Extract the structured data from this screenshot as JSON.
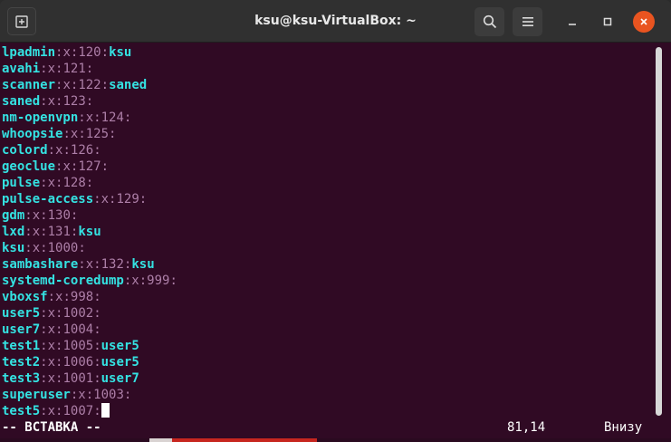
{
  "window": {
    "title": "ksu@ksu-VirtualBox: ~"
  },
  "icons": {
    "new_tab": "new-tab-icon",
    "search": "search-icon",
    "menu": "hamburger-menu-icon",
    "minimize": "minimize-icon",
    "maximize": "maximize-icon",
    "close": "close-icon"
  },
  "colors": {
    "terminal_bg": "#300a24",
    "username": "#34e2e2",
    "separator": "#ad7fa8",
    "close_button": "#e95420"
  },
  "lines": [
    {
      "name": "lpadmin",
      "gid": "120",
      "members": "ksu"
    },
    {
      "name": "avahi",
      "gid": "121",
      "members": ""
    },
    {
      "name": "scanner",
      "gid": "122",
      "members": "saned"
    },
    {
      "name": "saned",
      "gid": "123",
      "members": ""
    },
    {
      "name": "nm-openvpn",
      "gid": "124",
      "members": ""
    },
    {
      "name": "whoopsie",
      "gid": "125",
      "members": ""
    },
    {
      "name": "colord",
      "gid": "126",
      "members": ""
    },
    {
      "name": "geoclue",
      "gid": "127",
      "members": ""
    },
    {
      "name": "pulse",
      "gid": "128",
      "members": ""
    },
    {
      "name": "pulse-access",
      "gid": "129",
      "members": ""
    },
    {
      "name": "gdm",
      "gid": "130",
      "members": ""
    },
    {
      "name": "lxd",
      "gid": "131",
      "members": "ksu"
    },
    {
      "name": "ksu",
      "gid": "1000",
      "members": ""
    },
    {
      "name": "sambashare",
      "gid": "132",
      "members": "ksu"
    },
    {
      "name": "systemd-coredump",
      "gid": "999",
      "members": ""
    },
    {
      "name": "vboxsf",
      "gid": "998",
      "members": ""
    },
    {
      "name": "user5",
      "gid": "1002",
      "members": ""
    },
    {
      "name": "user7",
      "gid": "1004",
      "members": ""
    },
    {
      "name": "test1",
      "gid": "1005",
      "members": "user5"
    },
    {
      "name": "test2",
      "gid": "1006",
      "members": "user5"
    },
    {
      "name": "test3",
      "gid": "1001",
      "members": "user7"
    },
    {
      "name": "superuser",
      "gid": "1003",
      "members": ""
    },
    {
      "name": "test5",
      "gid": "1007",
      "members": ""
    }
  ],
  "field_sep": ":",
  "password_field": "x",
  "status": {
    "mode": "-- ВСТАВКА --",
    "position": "81,14",
    "scroll": "Внизу"
  }
}
